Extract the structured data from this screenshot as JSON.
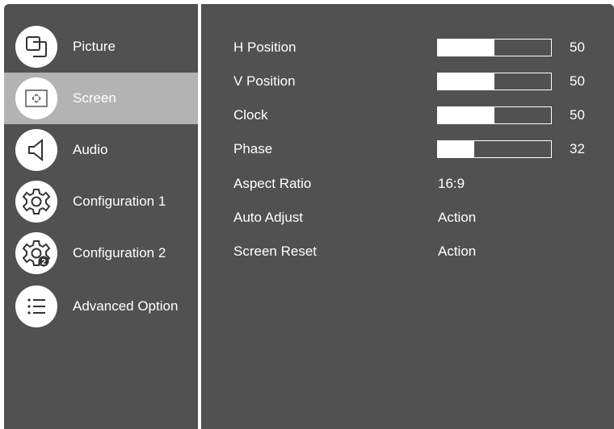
{
  "sidebar": {
    "items": [
      {
        "label": "Picture",
        "icon": "picture-icon",
        "active": false
      },
      {
        "label": "Screen",
        "icon": "screen-icon",
        "active": true
      },
      {
        "label": "Audio",
        "icon": "audio-icon",
        "active": false
      },
      {
        "label": "Configuration 1",
        "icon": "gear-icon",
        "active": false
      },
      {
        "label": "Configuration 2",
        "icon": "gear-2-icon",
        "active": false
      },
      {
        "label": "Advanced Option",
        "icon": "list-icon",
        "active": false
      }
    ]
  },
  "screen": {
    "settings": [
      {
        "label": "H Position",
        "type": "slider",
        "value": "50",
        "level": 0.5
      },
      {
        "label": "V Position",
        "type": "slider",
        "value": "50",
        "level": 0.5
      },
      {
        "label": "Clock",
        "type": "slider",
        "value": "50",
        "level": 0.5
      },
      {
        "label": "Phase",
        "type": "slider",
        "value": "32",
        "level": 0.32
      },
      {
        "label": "Aspect Ratio",
        "type": "text",
        "value": "16:9"
      },
      {
        "label": "Auto Adjust",
        "type": "text",
        "value": "Action"
      },
      {
        "label": "Screen Reset",
        "type": "text",
        "value": "Action"
      }
    ]
  },
  "colors": {
    "panel": "#515151",
    "highlight": "#b3b3b3",
    "text": "#ffffff"
  }
}
